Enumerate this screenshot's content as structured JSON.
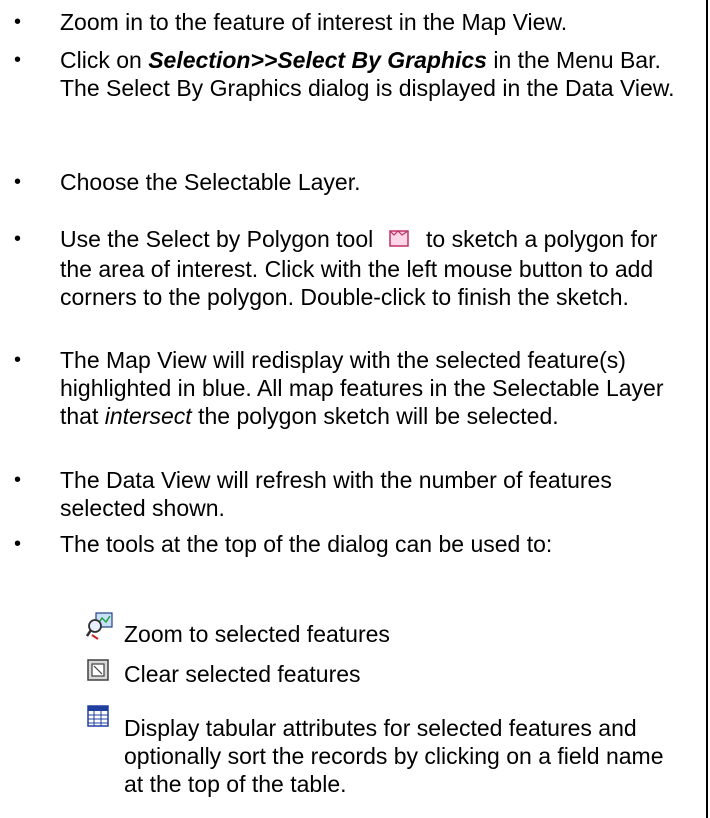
{
  "bullets": [
    {
      "text": "Zoom in to the feature of interest in the Map View."
    },
    {
      "pre": "Click on ",
      "bold": "Selection>>Select By Graphics",
      "post": " in the Menu Bar.  The Select By Graphics dialog is displayed in the Data View."
    },
    {
      "text": "Choose the Selectable Layer."
    },
    {
      "pre": "Use the Select by Polygon tool ",
      "post": " to sketch a polygon for the area of interest.  Click with the left mouse button to add corners to the polygon.  Double-click to finish the sketch.",
      "icon": "select-polygon-icon"
    },
    {
      "pre": "The Map View will redisplay with the selected feature(s) highlighted in blue.  All map features in the Selectable Layer that ",
      "italic": "intersect",
      "post": " the polygon sketch will be selected."
    },
    {
      "text": "The Data View will refresh with the number of features selected shown."
    },
    {
      "text": "The tools at the top of the dialog can be used to:"
    }
  ],
  "tools": [
    {
      "icon": "zoom-to-selected-icon",
      "label": "Zoom to selected features"
    },
    {
      "icon": "clear-selected-icon",
      "label": "Clear selected features"
    },
    {
      "icon": "table-icon",
      "label": "Display tabular attributes for selected features and optionally sort the records by clicking on a field name at the top of the table."
    }
  ]
}
